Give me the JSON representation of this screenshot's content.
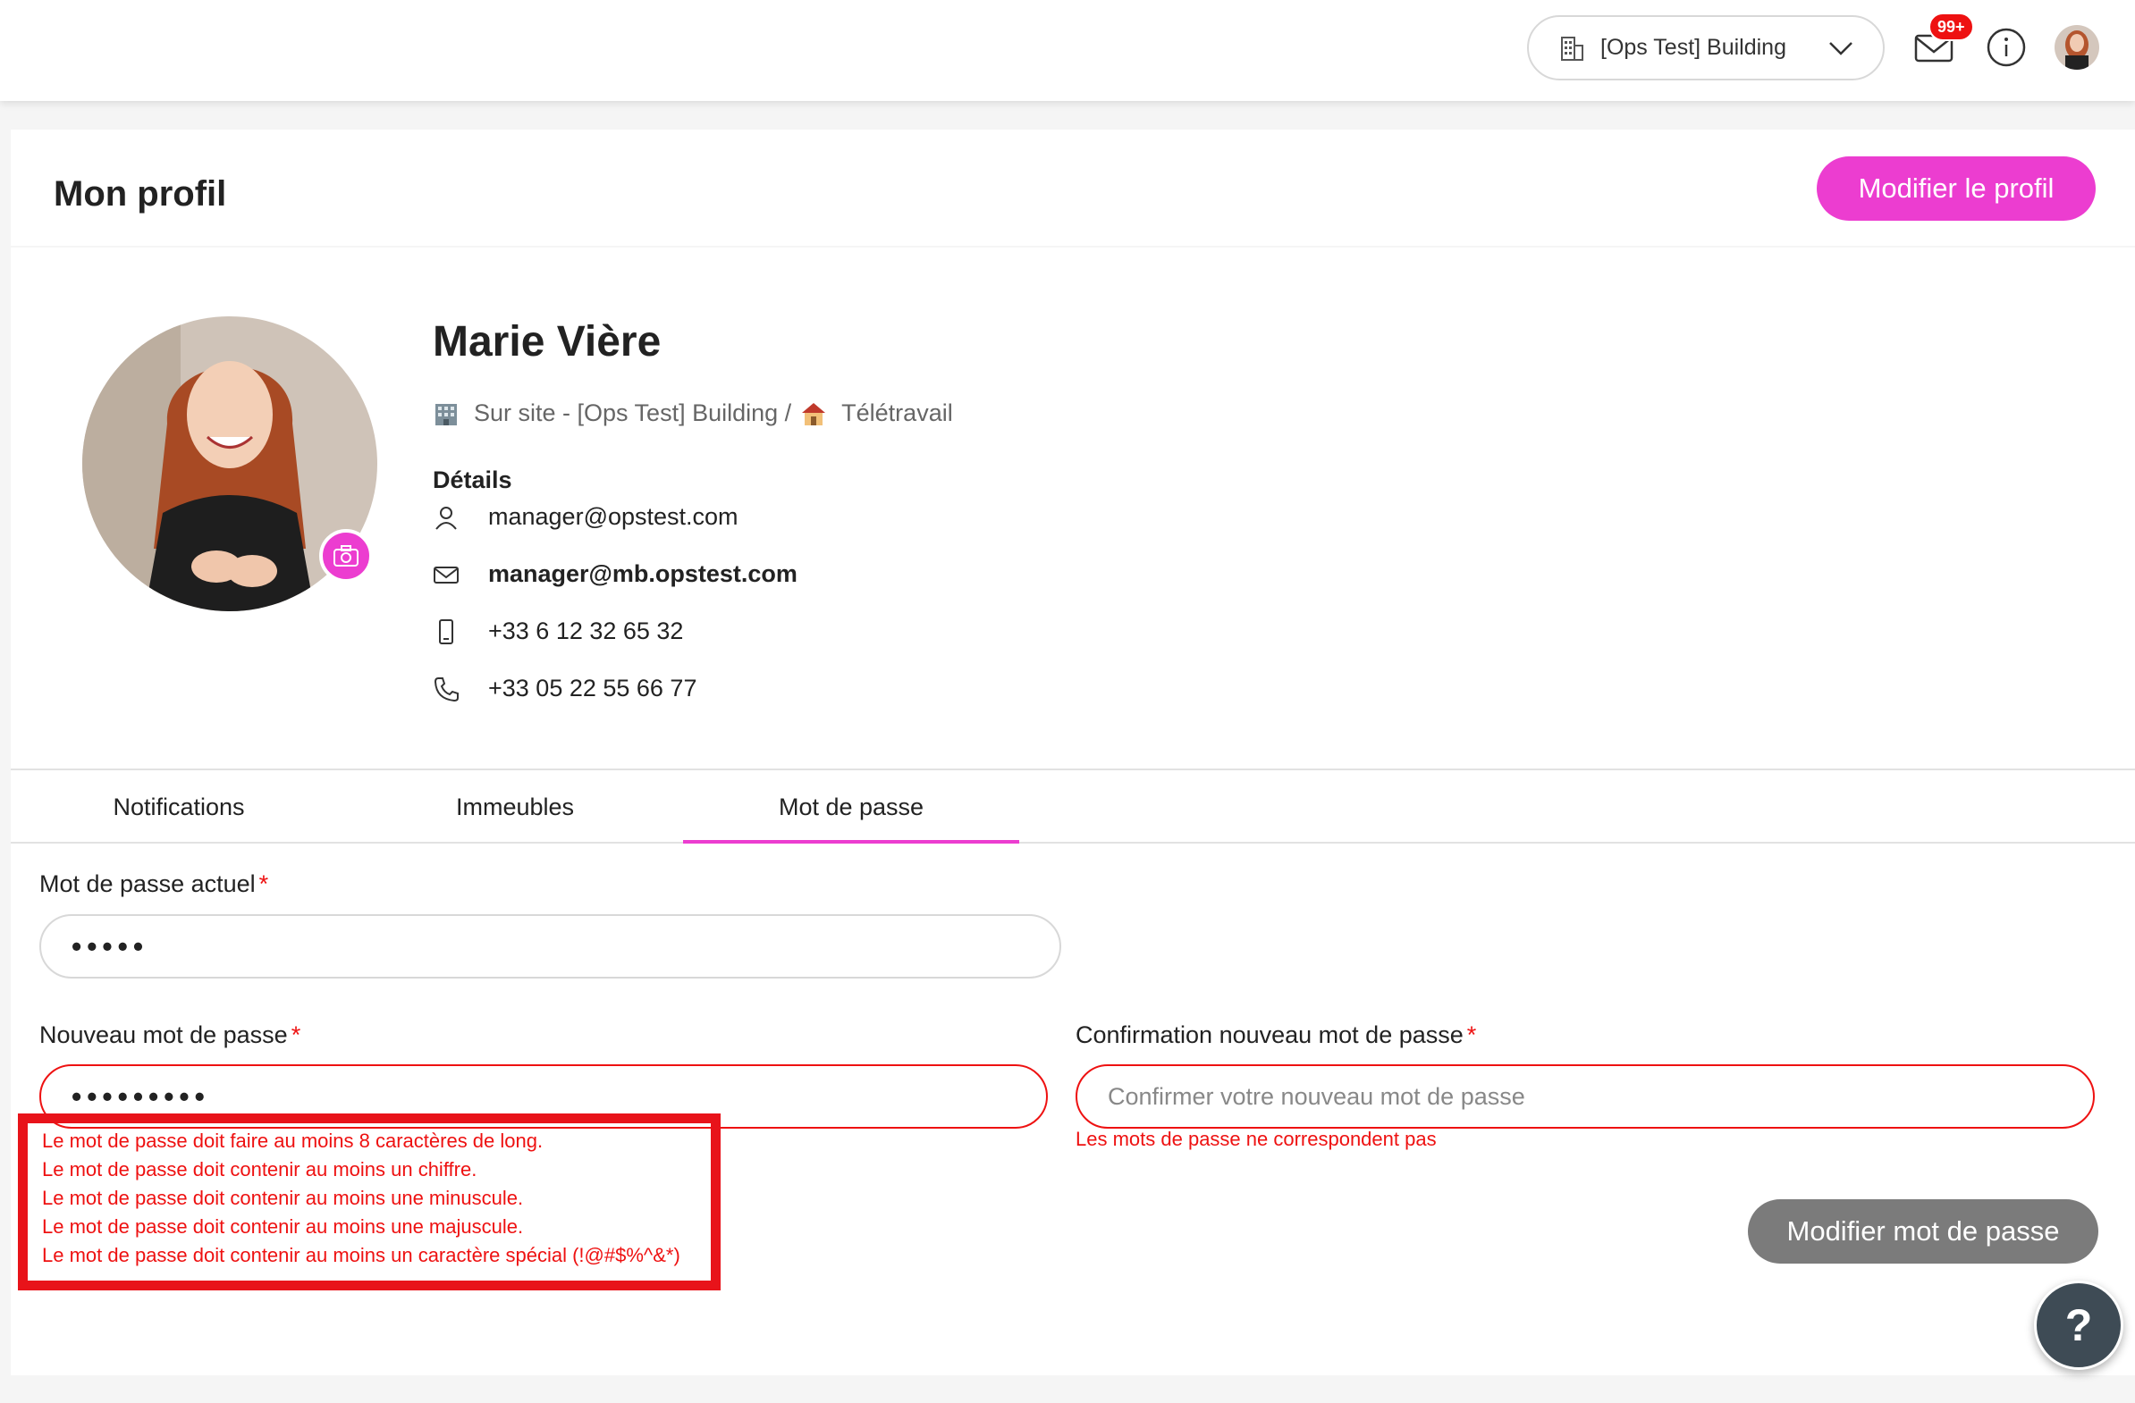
{
  "topbar": {
    "building_label": "[Ops Test] Building",
    "mail_badge": "99+"
  },
  "header": {
    "title": "Mon profil",
    "edit_button": "Modifier le profil"
  },
  "profile": {
    "name": "Marie Vière",
    "location_onsite": "Sur site - [Ops Test] Building /",
    "location_remote": "Télétravail",
    "details_title": "Détails",
    "username": "manager@opstest.com",
    "email": "manager@mb.opstest.com",
    "mobile": "+33 6 12 32 65 32",
    "phone": "+33 05 22 55 66 77"
  },
  "tabs": [
    {
      "label": "Notifications"
    },
    {
      "label": "Immeubles"
    },
    {
      "label": "Mot de passe",
      "active": true
    }
  ],
  "form": {
    "current_label": "Mot de passe actuel",
    "current_value": "•••••",
    "new_label": "Nouveau mot de passe",
    "new_value": "•••••••••",
    "confirm_label": "Confirmation nouveau mot de passe",
    "confirm_placeholder": "Confirmer votre nouveau mot de passe",
    "required_mark": "*",
    "new_errors": [
      "Le mot de passe doit faire au moins 8 caractères de long.",
      "Le mot de passe doit contenir au moins un chiffre.",
      "Le mot de passe doit contenir au moins une minuscule.",
      "Le mot de passe doit contenir au moins une majuscule.",
      "Le mot de passe doit contenir au moins un caractère spécial (!@#$%^&*)"
    ],
    "confirm_error": "Les mots de passe ne correspondent pas",
    "submit_label": "Modifier mot de passe"
  },
  "help": {
    "label": "?"
  },
  "colors": {
    "accent": "#ec3dd0",
    "error": "#e11111",
    "disabled_button": "#7b7b7b"
  }
}
